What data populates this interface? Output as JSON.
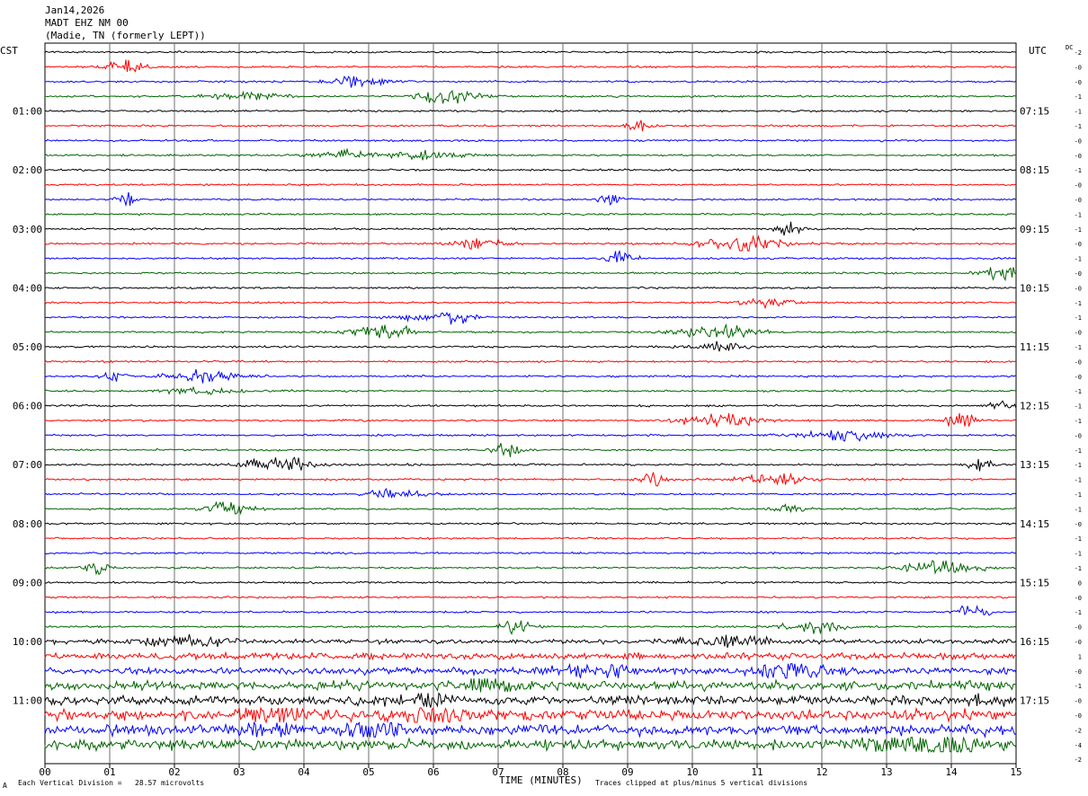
{
  "header": {
    "date": "Jan14,2026",
    "station": "MADT EHZ NM 00",
    "location": "(Madie, TN (formerly LEPT))"
  },
  "left_timezone": "CST",
  "right_timezone": "UTC",
  "dc_label": "DC",
  "footer": {
    "left_mark": "A",
    "scale_note": "Each Vertical Division =   28.57 microvolts",
    "clip_note": "Traces clipped at plus/minus 5 vertical divisions"
  },
  "chart_data": {
    "type": "line",
    "xlabel": "TIME (MINUTES)",
    "x_ticks": [
      "00",
      "01",
      "02",
      "03",
      "04",
      "05",
      "06",
      "07",
      "08",
      "09",
      "10",
      "11",
      "12",
      "13",
      "14",
      "15"
    ],
    "xlim": [
      0,
      15
    ],
    "trace_colors": [
      "#000000",
      "#ff0000",
      "#0000ff",
      "#006400"
    ],
    "trace_count": 48,
    "left_hour_labels": [
      "01:00",
      "02:00",
      "03:00",
      "04:00",
      "05:00",
      "06:00",
      "07:00",
      "08:00",
      "09:00",
      "10:00",
      "11:00"
    ],
    "right_hour_labels": [
      "07:15",
      "08:15",
      "09:15",
      "10:15",
      "11:15",
      "12:15",
      "13:15",
      "14:15",
      "15:15",
      "16:15",
      "17:15"
    ],
    "dc_offsets": [
      "-2",
      "-0",
      "-0",
      "-1",
      "-1",
      "-1",
      "-0",
      "-0",
      "-1",
      "-0",
      "-0",
      "-1",
      "-1",
      "-0",
      "-1",
      "-0",
      "-0",
      "-1",
      "-1",
      "-0",
      "-1",
      "-0",
      "-0",
      "-1",
      "-1",
      "-1",
      "-0",
      "-1",
      "-1",
      "-1",
      "-1",
      "-1",
      "-0",
      "-1",
      "-1",
      "-1",
      "0",
      "-0",
      "-1",
      "-0",
      "-0",
      "1",
      "-0",
      "-1",
      "-0",
      "-0",
      "-2",
      "-4",
      "-2"
    ],
    "annotation": "Traces clipped at plus/minus 5 vertical divisions"
  }
}
